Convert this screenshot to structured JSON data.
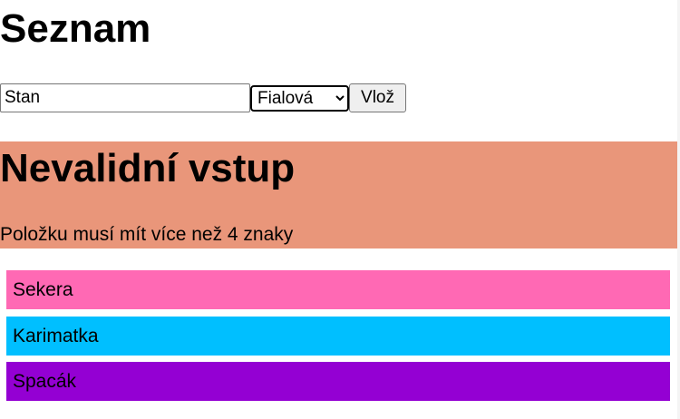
{
  "heading": "Seznam",
  "form": {
    "input_value": "Stan",
    "selected_color": "Fialová",
    "submit_label": "Vlož"
  },
  "error": {
    "title": "Nevalidní vstup",
    "message": "Položku musí mít více než 4 znaky",
    "background": "#e9967a"
  },
  "items": [
    {
      "label": "Sekera",
      "color": "#ff69b4"
    },
    {
      "label": "Karimatka",
      "color": "#00bfff"
    },
    {
      "label": "Spacák",
      "color": "#9400d3"
    }
  ]
}
